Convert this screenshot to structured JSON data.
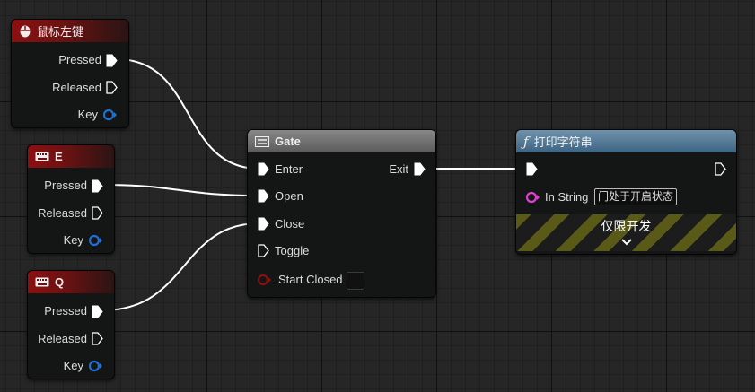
{
  "nodes": {
    "left_mouse": {
      "title": "鼠标左键",
      "pins": {
        "pressed": "Pressed",
        "released": "Released",
        "key": "Key"
      }
    },
    "key_e": {
      "title": "E",
      "pins": {
        "pressed": "Pressed",
        "released": "Released",
        "key": "Key"
      }
    },
    "key_q": {
      "title": "Q",
      "pins": {
        "pressed": "Pressed",
        "released": "Released",
        "key": "Key"
      }
    },
    "gate": {
      "title": "Gate",
      "pins": {
        "enter": "Enter",
        "open": "Open",
        "close": "Close",
        "toggle": "Toggle",
        "start_closed": "Start Closed",
        "exit": "Exit"
      }
    },
    "print_string": {
      "title": "打印字符串",
      "in_string_label": "In String",
      "in_string_value": "门处于开启状态",
      "dev_only_label": "仅限开发"
    }
  },
  "colors": {
    "exec_wire": "#ffffff",
    "key_pin": "#1e6fd8",
    "string_pin": "#e23fd3",
    "bool_pin": "#8b0f0f"
  },
  "icons": {
    "left_mouse": "mouse-icon",
    "key_e": "keyboard-icon",
    "key_q": "keyboard-icon",
    "gate": "gate-icon",
    "print_string": "function-icon",
    "expand": "chevron-down-icon"
  }
}
